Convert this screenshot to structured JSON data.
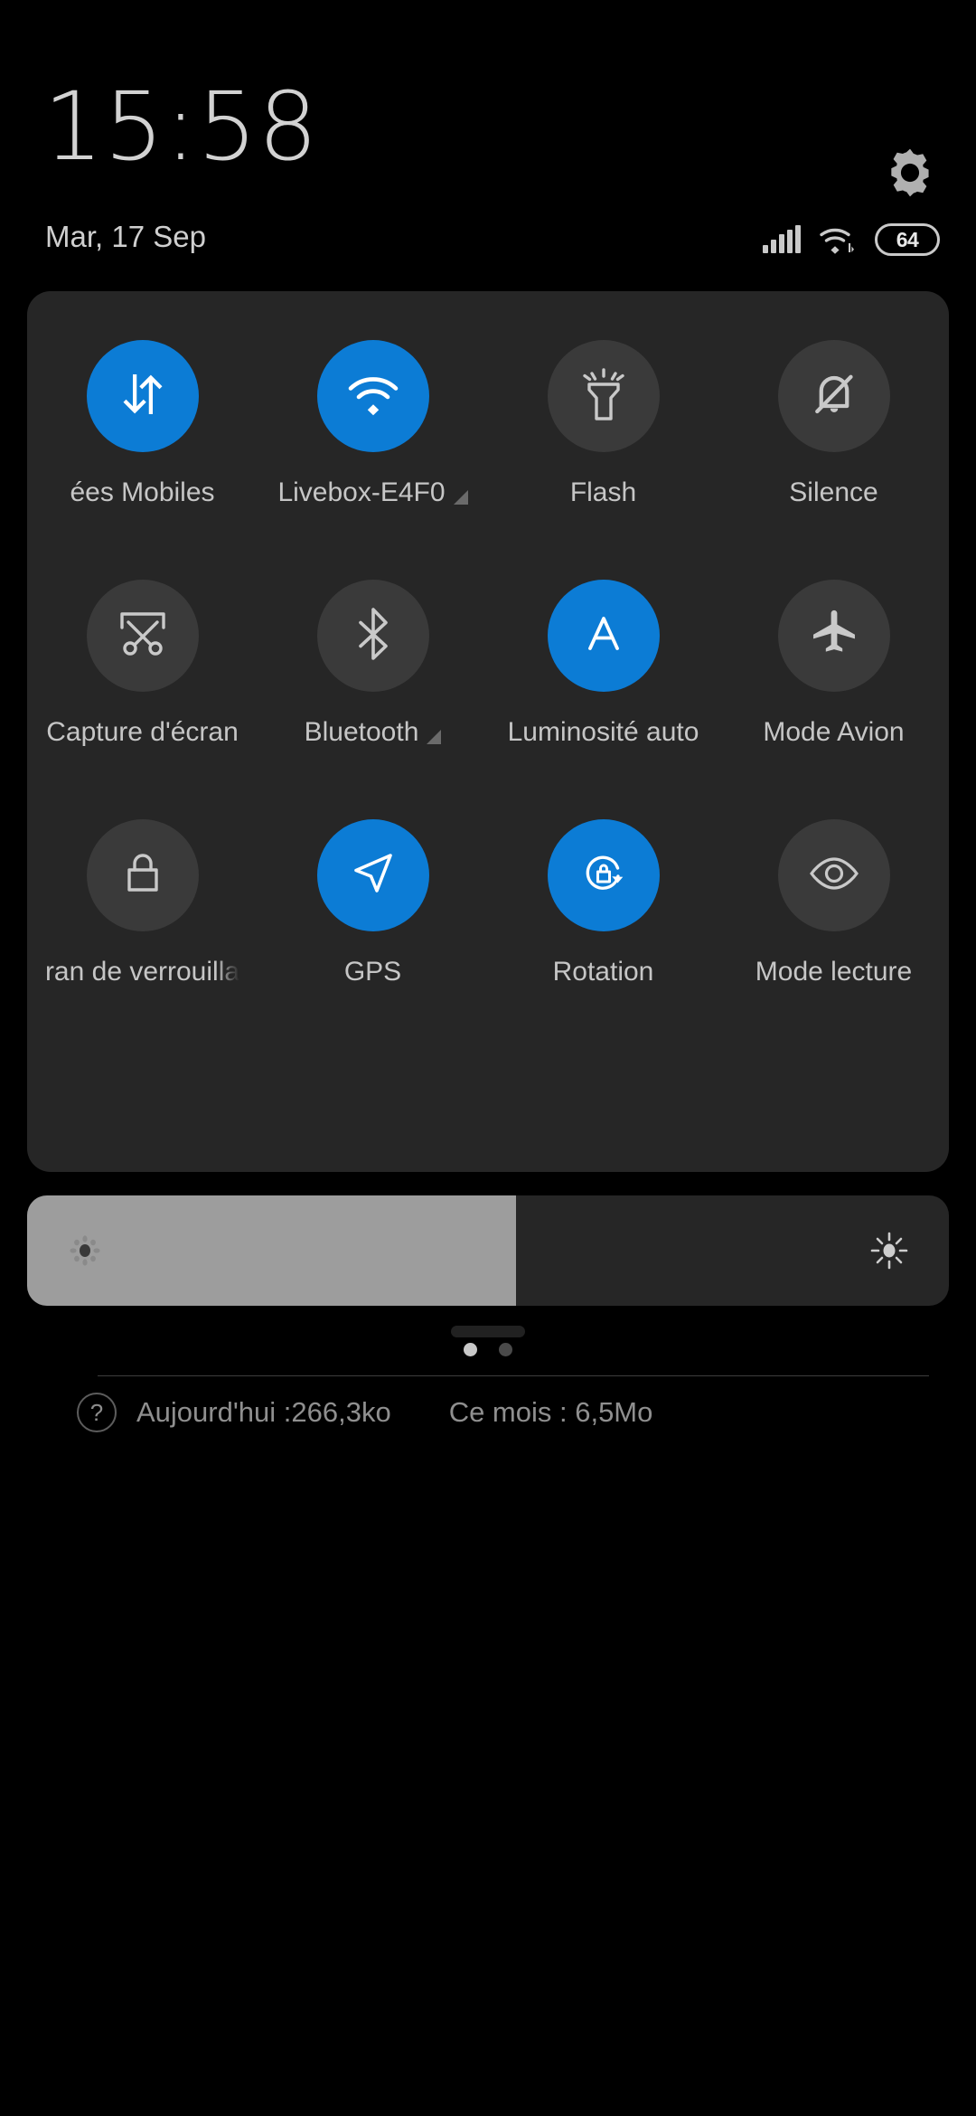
{
  "status_bar": {
    "clock": "15:58",
    "date": "Mar, 17 Sep",
    "battery_level": "64",
    "settings_icon": "gear-icon",
    "signal_icon": "cellular-signal-icon",
    "wifi_icon": "wifi-status-icon",
    "battery_icon": "battery-icon"
  },
  "quick_settings": {
    "accent_color": "#0c7cd5",
    "inactive_color": "#3a3a3a",
    "panel_color": "#262626",
    "tiles": [
      {
        "label": "ées Mobiles",
        "icon": "mobile-data-icon",
        "active": true,
        "badge": false,
        "clip": "left"
      },
      {
        "label": "Livebox-E4F0",
        "icon": "wifi-icon",
        "active": true,
        "badge": true,
        "clip": "none"
      },
      {
        "label": "Flash",
        "icon": "flashlight-icon",
        "active": false,
        "badge": false,
        "clip": "none"
      },
      {
        "label": "Silence",
        "icon": "bell-off-icon",
        "active": false,
        "badge": false,
        "clip": "none"
      },
      {
        "label": "Capture d'écran",
        "icon": "screenshot-icon",
        "active": false,
        "badge": false,
        "clip": "none"
      },
      {
        "label": "Bluetooth",
        "icon": "bluetooth-icon",
        "active": false,
        "badge": true,
        "clip": "none"
      },
      {
        "label": "Luminosité auto",
        "icon": "auto-brightness-icon",
        "active": true,
        "badge": false,
        "clip": "none"
      },
      {
        "label": "Mode Avion",
        "icon": "airplane-icon",
        "active": false,
        "badge": false,
        "clip": "none"
      },
      {
        "label": "ran de verrouilla",
        "icon": "lock-icon",
        "active": false,
        "badge": false,
        "clip": "right"
      },
      {
        "label": "GPS",
        "icon": "location-arrow-icon",
        "active": true,
        "badge": false,
        "clip": "none"
      },
      {
        "label": "Rotation",
        "icon": "rotation-lock-icon",
        "active": true,
        "badge": false,
        "clip": "none"
      },
      {
        "label": "Mode lecture",
        "icon": "eye-icon",
        "active": false,
        "badge": false,
        "clip": "none"
      }
    ],
    "pages": {
      "count": 2,
      "current": 1
    },
    "data_usage": {
      "help_label": "?",
      "today": "Aujourd'hui :266,3ko",
      "month": "Ce mois : 6,5Mo"
    }
  },
  "brightness": {
    "value_percent": 53,
    "low_icon": "brightness-low-icon",
    "high_icon": "brightness-high-icon"
  },
  "drag_handle": "panel-drag-handle"
}
